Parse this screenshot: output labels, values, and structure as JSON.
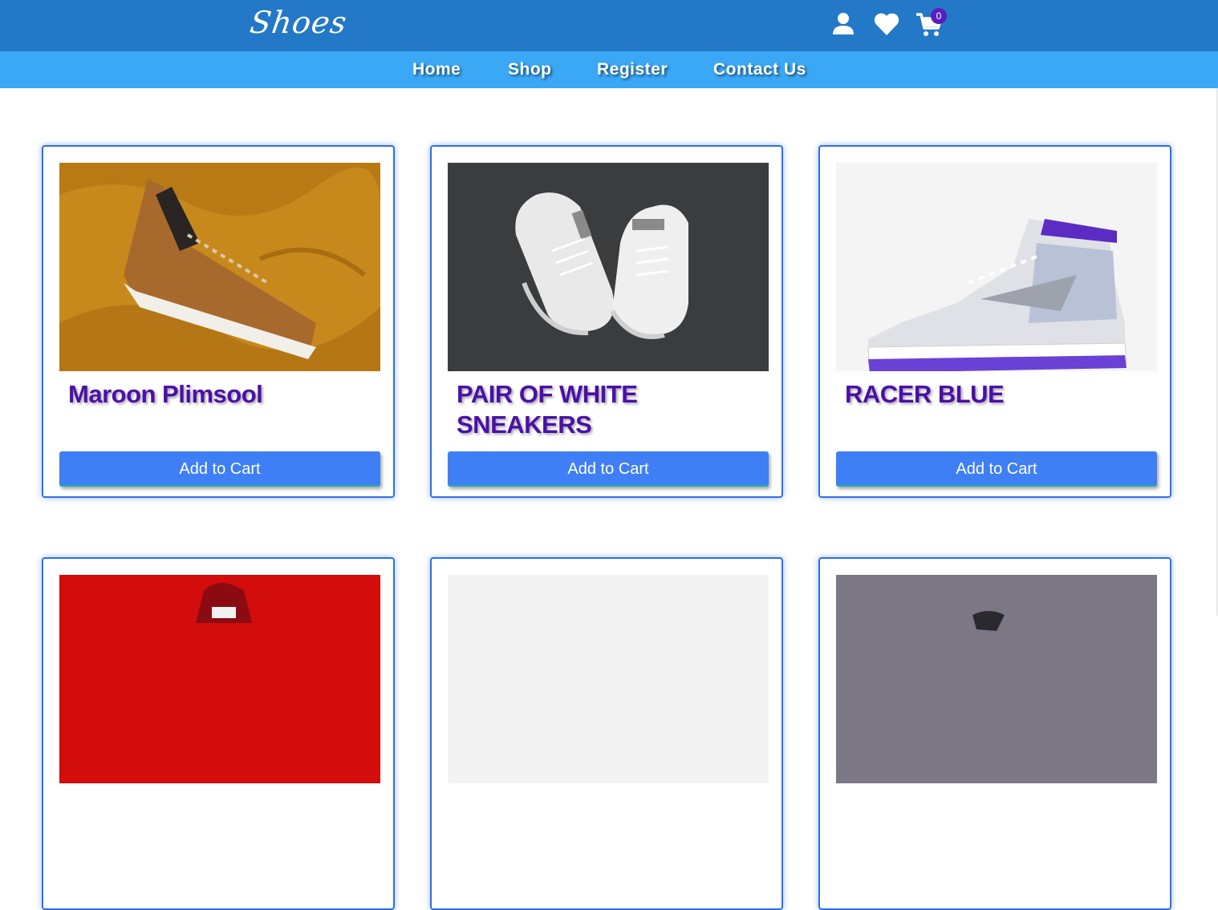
{
  "header": {
    "logo": "Shoes",
    "cart_count": "0",
    "icons": [
      "account-icon",
      "heart-icon",
      "cart-icon"
    ],
    "colors": {
      "topbar": "#2378c7",
      "navbar": "#3aa8f5",
      "accent": "#3f7ff5",
      "title": "#4a10a8"
    }
  },
  "nav": {
    "items": [
      {
        "label": "Home"
      },
      {
        "label": "Shop"
      },
      {
        "label": "Register"
      },
      {
        "label": "Contact Us"
      }
    ]
  },
  "products": [
    {
      "name": "Maroon Plimsool",
      "button": "Add to Cart"
    },
    {
      "name": "PAIR OF WHITE SNEAKERS",
      "button": "Add to Cart"
    },
    {
      "name": "RACER BLUE",
      "button": "Add to Cart"
    }
  ]
}
